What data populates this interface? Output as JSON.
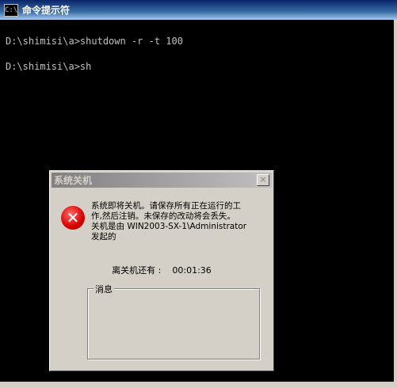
{
  "console": {
    "title": "命令提示符",
    "icon_text": "C:\\",
    "lines": [
      "D:\\shimisi\\a>shutdown -r -t 100",
      "D:\\shimisi\\a>sh"
    ]
  },
  "dialog": {
    "title": "系统关机",
    "close_label": "×",
    "message_lines": [
      "系统即将关机。请保存所有正在运行的工",
      "作,然后注销。未保存的改动将会丢失。",
      "关机是由 WIN2003-SX-1\\Administrator",
      "发起的"
    ],
    "countdown_label": "离关机还有 :",
    "countdown_value": "00:01:36",
    "group_label": "消息",
    "icon": "error-icon"
  }
}
